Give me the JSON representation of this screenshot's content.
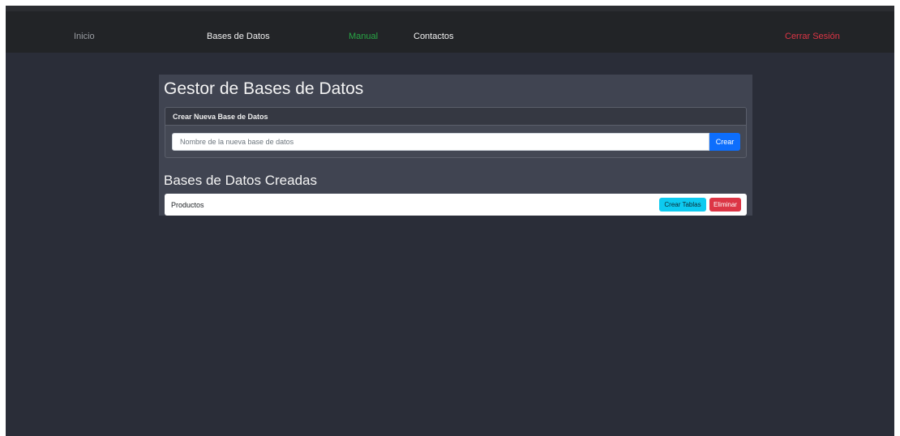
{
  "navbar": {
    "links": [
      {
        "label": "Inicio",
        "color": "#9a9da2"
      },
      {
        "label": "Bases de Datos",
        "color": "#f1f1f1"
      },
      {
        "label": "Manual",
        "color": "#28a745"
      },
      {
        "label": "Contactos",
        "color": "#f1f1f1"
      }
    ],
    "logout_label": "Cerrar Sesión",
    "logout_color": "#dc3545"
  },
  "main": {
    "title": "Gestor de Bases de Datos",
    "create_card": {
      "header": "Crear Nueva Base de Datos",
      "input_placeholder": "Nombre de la nueva base de datos",
      "input_value": "",
      "submit_label": "Crear"
    },
    "list_title": "Bases de Datos Creadas",
    "databases": [
      {
        "name": "Productos",
        "create_tables_label": "Crear Tablas",
        "delete_label": "Eliminar"
      }
    ]
  },
  "colors": {
    "background": "#2a2d38",
    "navbar": "#222427",
    "panel": "#404451",
    "primary": "#0d6efd",
    "info": "#0dcaf0",
    "danger": "#dc3545",
    "success": "#28a745"
  }
}
